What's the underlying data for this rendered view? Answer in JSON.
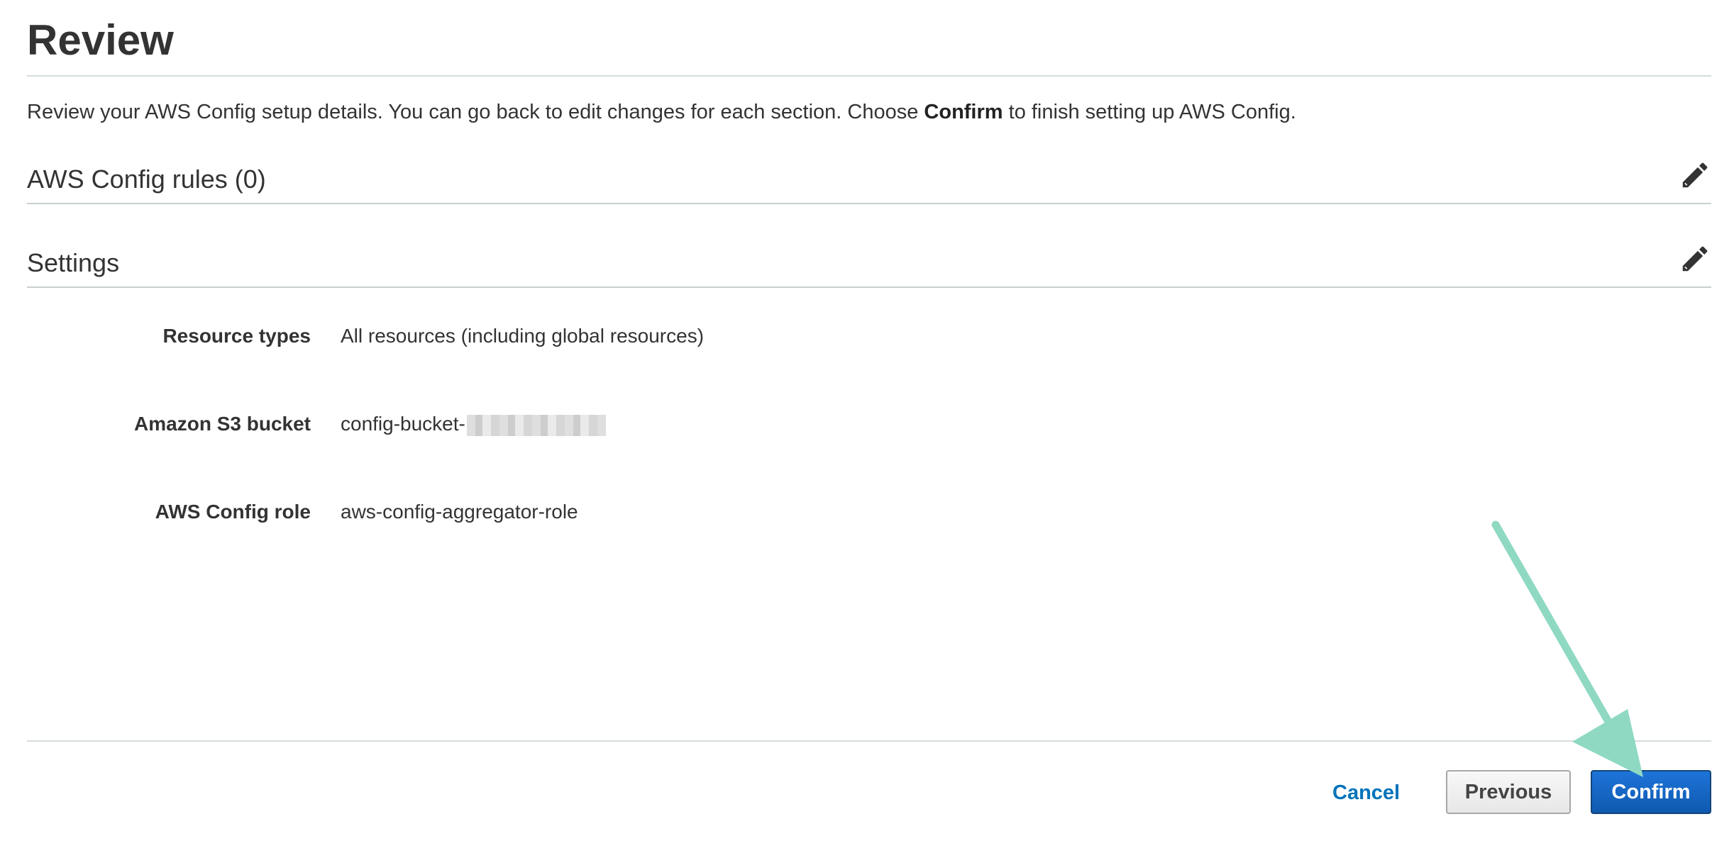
{
  "page": {
    "title": "Review",
    "intro_before": "Review your AWS Config setup details. You can go back to edit changes for each section. Choose ",
    "intro_bold": "Confirm",
    "intro_after": " to finish setting up AWS Config."
  },
  "sections": {
    "rules": {
      "title": "AWS Config rules (0)",
      "edit_icon": "pencil-icon"
    },
    "settings": {
      "title": "Settings",
      "edit_icon": "pencil-icon"
    }
  },
  "settings": {
    "resource_types": {
      "label": "Resource types",
      "value": "All resources (including global resources)"
    },
    "s3_bucket": {
      "label": "Amazon S3 bucket",
      "value": "config-bucket-"
    },
    "config_role": {
      "label": "AWS Config role",
      "value": "aws-config-aggregator-role"
    }
  },
  "footer": {
    "cancel_label": "Cancel",
    "previous_label": "Previous",
    "confirm_label": "Confirm"
  },
  "colors": {
    "link": "#0073bb",
    "primary_button": "#1d74d8",
    "annotation_arrow": "#8fd9c3"
  }
}
